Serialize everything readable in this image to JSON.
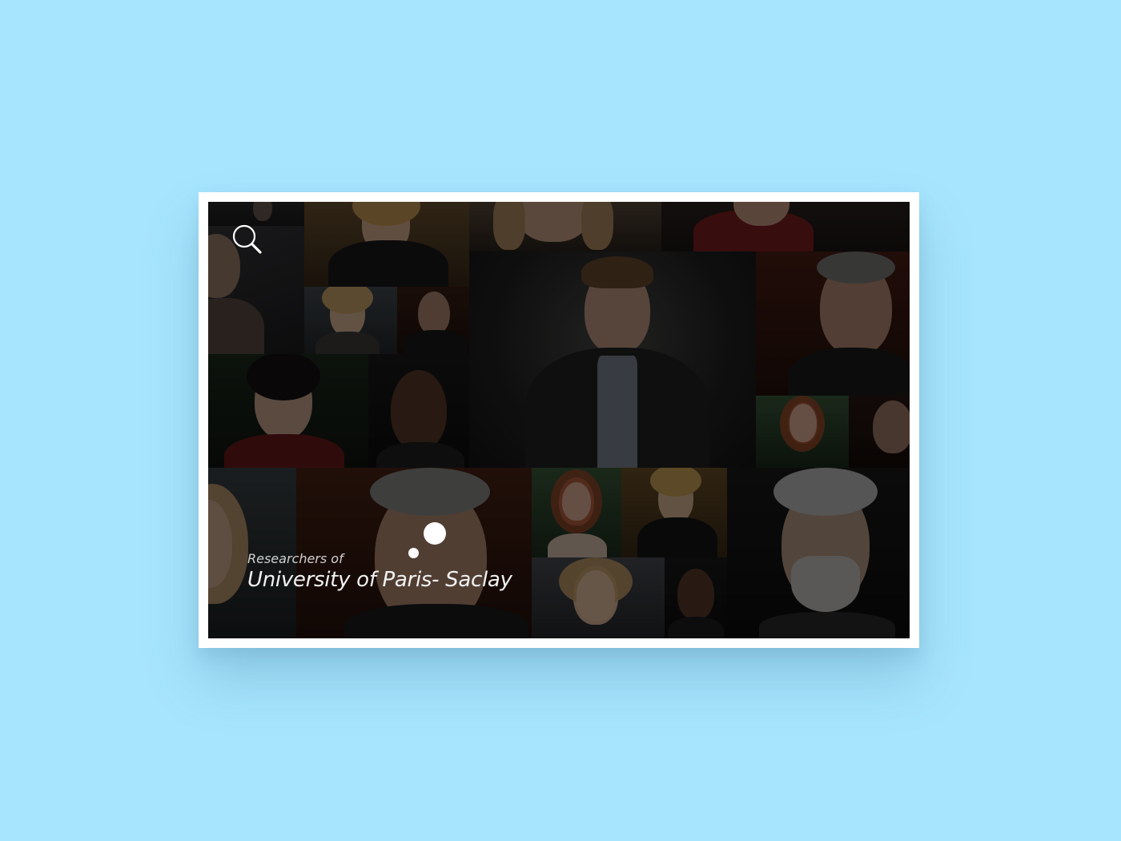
{
  "app": {
    "caption_prefix": "Researchers of",
    "caption_title": "University of Paris- Saclay"
  },
  "toolbar": {
    "search_icon": "search-icon"
  },
  "colors": {
    "background": "#a7e5fe",
    "frame": "#ffffff",
    "overlay": "#000000",
    "text": "#f2f2f2"
  },
  "gallery": {
    "tiles": [
      {
        "name": "portrait-tile-1"
      },
      {
        "name": "portrait-tile-2"
      },
      {
        "name": "portrait-tile-3"
      },
      {
        "name": "portrait-tile-4"
      },
      {
        "name": "portrait-tile-5"
      },
      {
        "name": "portrait-tile-6"
      },
      {
        "name": "portrait-tile-7"
      },
      {
        "name": "portrait-tile-8"
      },
      {
        "name": "portrait-tile-9"
      },
      {
        "name": "portrait-tile-10"
      },
      {
        "name": "portrait-tile-11"
      },
      {
        "name": "portrait-tile-12"
      },
      {
        "name": "portrait-tile-13"
      },
      {
        "name": "portrait-tile-14"
      },
      {
        "name": "portrait-tile-15"
      },
      {
        "name": "portrait-tile-16"
      },
      {
        "name": "portrait-tile-17"
      },
      {
        "name": "portrait-tile-18"
      },
      {
        "name": "portrait-tile-19"
      },
      {
        "name": "portrait-tile-20"
      }
    ]
  }
}
